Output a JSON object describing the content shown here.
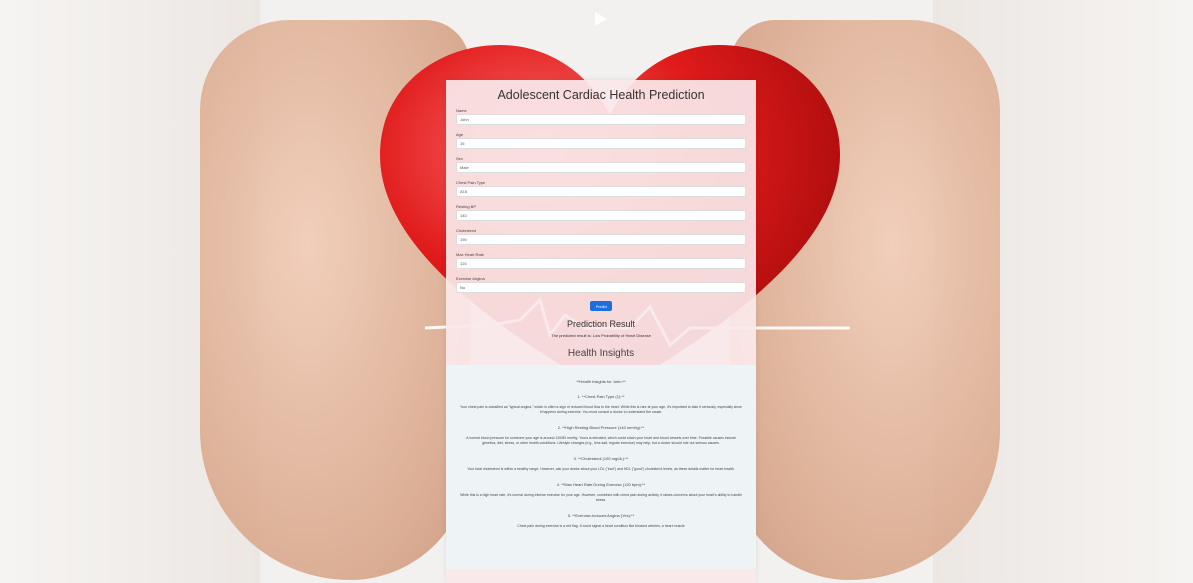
{
  "window": {
    "title": "Adolescent Cardiac Health Prediction"
  },
  "form": {
    "fields": [
      {
        "label": "Name",
        "value": "John"
      },
      {
        "label": "Age",
        "value": "15"
      },
      {
        "label": "Sex",
        "value": "Male"
      },
      {
        "label": "Chest Pain Type",
        "value": "ATA"
      },
      {
        "label": "Resting BP",
        "value": "140"
      },
      {
        "label": "Cholesterol",
        "value": "190"
      },
      {
        "label": "Max Heart Rate",
        "value": "120"
      },
      {
        "label": "Exercise Angina",
        "value": "No"
      }
    ],
    "predict_label": "Predict"
  },
  "result": {
    "title": "Prediction Result",
    "text": "The predicted result is: Low Probability of Heart Disease"
  },
  "insights": {
    "title": "Health Insights",
    "intro": "**Health Insights for John:**",
    "items": [
      {
        "heading": "1. **Chest Pain Type (1):**",
        "text": "Your chest pain is classified as \"typical angina,\" which is often a sign of reduced blood flow to the heart. While this is rare at your age, it's important to take it seriously, especially since it happens during exercise. You must consult a doctor to understand the cause."
      },
      {
        "heading": "2. **High Resting Blood Pressure (140 mmHg):**",
        "text": "A normal blood pressure for someone your age is around 120/80 mmHg. Yours is elevated, which could strain your heart and blood vessels over time. Possible causes include genetics, diet, stress, or other health conditions. Lifestyle changes (e.g., less salt, regular exercise) may help, but a doctor should rule out serious causes."
      },
      {
        "heading": "3. **Cholesterol (190 mg/dL):**",
        "text": "Your total cholesterol is within a healthy range. However, ask your doctor about your LDL (\"bad\") and HDL (\"good\") cholesterol levels, as these details matter for heart health."
      },
      {
        "heading": "4. **Max Heart Rate During Exercise (120 bpm):**",
        "text": "While this is a high heart rate, it's normal during intense exercise for your age. However, combined with chest pain during activity, it raises concerns about your heart's ability to handle stress."
      },
      {
        "heading": "5. **Exercise-Induced Angina (Yes):**",
        "text": "Chest pain during exercise is a red flag. It could signal a heart condition like blocked arteries, a heart muscle"
      }
    ]
  }
}
